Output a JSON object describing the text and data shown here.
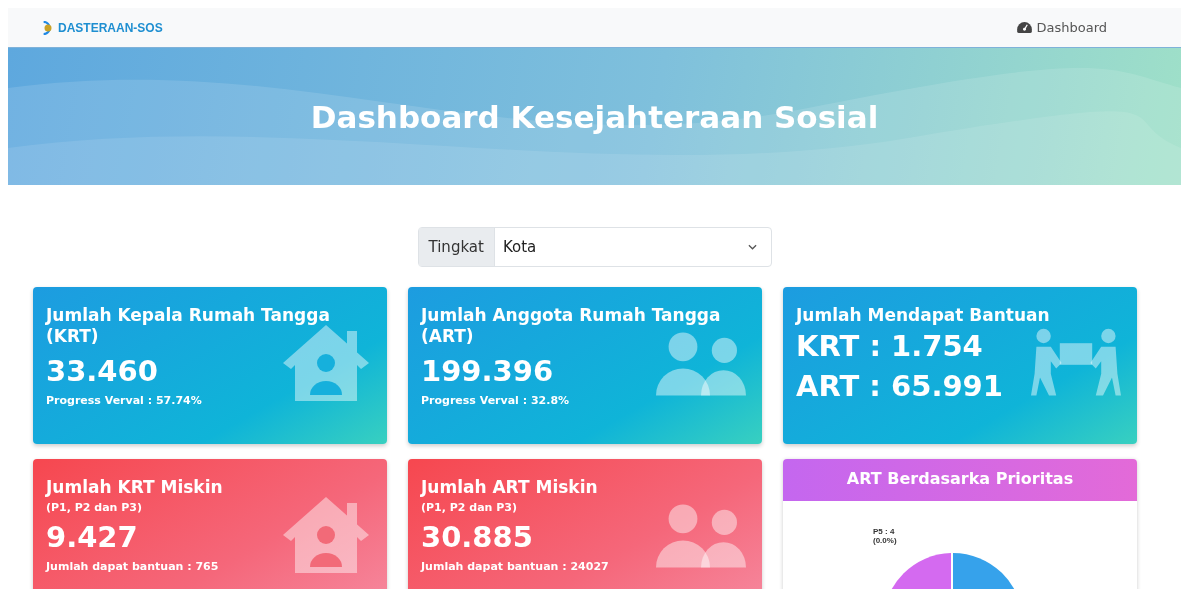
{
  "navbar": {
    "brand": "DASTERAAN-SOS",
    "link": "Dashboard"
  },
  "banner": {
    "title": "Dashboard Kesejahteraan Sosial"
  },
  "filter": {
    "label": "Tingkat",
    "value": "Kota"
  },
  "cards": [
    {
      "kind": "house",
      "title": "Jumlah Kepala Rumah Tangga (KRT)",
      "values": [
        "33.460"
      ],
      "footer": "Progress Verval : 57.74%"
    },
    {
      "kind": "people",
      "title": "Jumlah Anggota Rumah Tangga (ART)",
      "values": [
        "199.396"
      ],
      "footer": "Progress Verval : 32.8%"
    },
    {
      "kind": "carry",
      "title": "Jumlah Mendapat Bantuan",
      "values": [
        "KRT : 1.754",
        "ART : 65.991"
      ]
    },
    {
      "kind": "house",
      "title": "Jumlah KRT Miskin",
      "subtitle": "(P1, P2 dan P3)",
      "values": [
        "9.427"
      ],
      "footer": "Jumlah dapat bantuan : 765"
    },
    {
      "kind": "people",
      "title": "Jumlah ART Miskin",
      "subtitle": "(P1, P2 dan P3)",
      "values": [
        "30.885"
      ],
      "footer": "Jumlah dapat bantuan : 24027"
    },
    {
      "kind": "chart",
      "title": "ART Berdasarka Prioritas",
      "labels": [
        "P5 : 4",
        "(0.0%)"
      ]
    }
  ]
}
